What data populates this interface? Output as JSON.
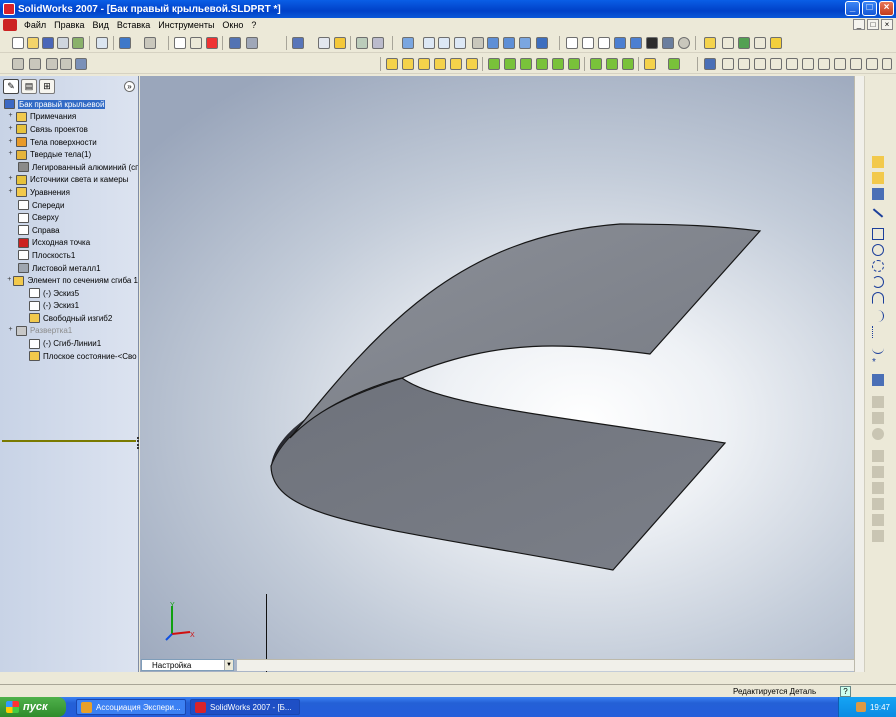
{
  "window": {
    "title": "SolidWorks 2007 - [Бак правый крыльевой.SLDPRT *]",
    "min": "_",
    "max": "□",
    "close": "×"
  },
  "menu": {
    "items": [
      "Файл",
      "Правка",
      "Вид",
      "Вставка",
      "Инструменты",
      "Окно",
      "?"
    ],
    "doc_min": "_",
    "doc_max": "□",
    "doc_close": "×"
  },
  "feature_manager": {
    "collapse_glyph": "»",
    "items": [
      {
        "label": "Бак правый крыльевой",
        "icon": "part-icon",
        "selected": true
      },
      {
        "label": "Примечания",
        "icon": "annotations-icon"
      },
      {
        "label": "Связь проектов",
        "icon": "design-binder-icon"
      },
      {
        "label": "Тела поверхности",
        "icon": "surface-bodies-icon"
      },
      {
        "label": "Твердые тела(1)",
        "icon": "solid-bodies-icon"
      },
      {
        "label": "Легированный алюминий (спл",
        "icon": "material-icon"
      },
      {
        "label": "Источники света и камеры",
        "icon": "lights-icon"
      },
      {
        "label": "Уравнения",
        "icon": "equations-icon"
      },
      {
        "label": "Спереди",
        "icon": "plane-icon"
      },
      {
        "label": "Сверху",
        "icon": "plane-icon"
      },
      {
        "label": "Справа",
        "icon": "plane-icon"
      },
      {
        "label": "Исходная точка",
        "icon": "origin-icon"
      },
      {
        "label": "Плоскость1",
        "icon": "plane-icon"
      },
      {
        "label": "Листовой металл1",
        "icon": "sheetmetal-icon"
      },
      {
        "label": "Элемент по сечениям сгиба 1",
        "icon": "lofted-bend-icon"
      },
      {
        "label": "(-) Эскиз5",
        "icon": "sketch-icon"
      },
      {
        "label": "(-) Эскиз1",
        "icon": "sketch-icon"
      },
      {
        "label": "Свободный изгиб2",
        "icon": "bend-icon"
      },
      {
        "label": "Развертка1",
        "icon": "flatten-icon",
        "suppressed": true
      },
      {
        "label": "(-) Сгиб-Линии1",
        "icon": "sketch-icon"
      },
      {
        "label": "Плоское состояние-<Сво",
        "icon": "bend-icon"
      }
    ]
  },
  "config": {
    "label": "Настройка"
  },
  "status": {
    "text": "Редактируется Деталь",
    "help": "?"
  },
  "taskbar": {
    "start": "пуск",
    "tasks": [
      "Ассоциация Экспери...",
      "SolidWorks 2007 - [Б..."
    ],
    "clock": "19:47"
  },
  "colors": {
    "surface": "#7f838c",
    "surface_edge": "#1a1a1a",
    "title_bar": "#0a5ee6",
    "axis_x": "#d01010",
    "axis_y": "#10a010",
    "axis_z": "#1050e0"
  }
}
